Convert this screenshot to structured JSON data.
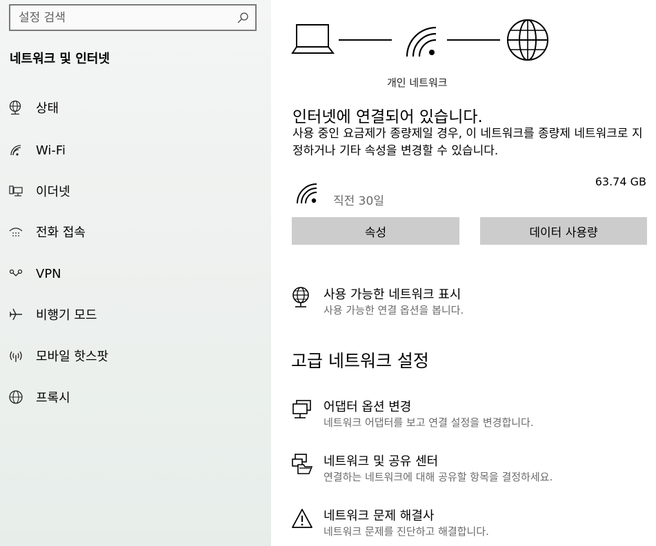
{
  "search": {
    "placeholder": "설정 검색"
  },
  "sidebar": {
    "title": "네트워크 및 인터넷",
    "items": [
      {
        "label": "상태",
        "icon": "globe-status-icon"
      },
      {
        "label": "Wi-Fi",
        "icon": "wifi-icon"
      },
      {
        "label": "이더넷",
        "icon": "ethernet-icon"
      },
      {
        "label": "전화 접속",
        "icon": "dialup-icon"
      },
      {
        "label": "VPN",
        "icon": "vpn-icon"
      },
      {
        "label": "비행기 모드",
        "icon": "airplane-icon"
      },
      {
        "label": "모바일 핫스팟",
        "icon": "hotspot-icon"
      },
      {
        "label": "프록시",
        "icon": "globe-icon"
      }
    ]
  },
  "main": {
    "network_name": "개인 네트워크",
    "status_title": "인터넷에 연결되어 있습니다.",
    "status_desc": "사용 중인 요금제가 종량제일 경우, 이 네트워크를 종량제 네트워크로 지정하거나 기타 속성을 변경할 수 있습니다.",
    "usage": {
      "period": "직전 30일",
      "amount": "63.74 GB"
    },
    "buttons": {
      "properties": "속성",
      "data_usage": "데이터 사용량"
    },
    "show_networks": {
      "title": "사용 가능한 네트워크 표시",
      "subtitle": "사용 가능한 연결 옵션을 봅니다."
    },
    "advanced_heading": "고급 네트워크 설정",
    "advanced": [
      {
        "title": "어댑터 옵션 변경",
        "subtitle": "네트워크 어댑터를 보고 연결 설정을 변경합니다.",
        "icon": "adapter-icon"
      },
      {
        "title": "네트워크 및 공유 센터",
        "subtitle": "연결하는 네트워크에 대해 공유할 항목을 결정하세요.",
        "icon": "sharing-center-icon"
      },
      {
        "title": "네트워크 문제 해결사",
        "subtitle": "네트워크 문제를 진단하고 해결합니다.",
        "icon": "warning-icon"
      }
    ]
  }
}
